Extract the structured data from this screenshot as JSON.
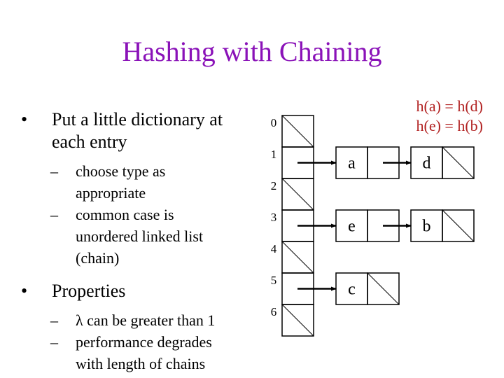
{
  "slide": {
    "title": "Hashing with Chaining",
    "bullets": [
      {
        "text_lines": [
          "Put a little dictionary at",
          "each entry"
        ],
        "subs": [
          {
            "lines": [
              "choose type as",
              "appropriate"
            ]
          },
          {
            "lines": [
              "common case is",
              "unordered linked list",
              "(chain)"
            ]
          }
        ]
      },
      {
        "text_lines": [
          "Properties"
        ],
        "subs": [
          {
            "lines": [
              "λ can be greater than 1"
            ]
          },
          {
            "lines": [
              "performance degrades",
              "with length of chains"
            ]
          }
        ]
      }
    ],
    "bullet_glyph": "•",
    "dash_glyph": "–",
    "annotation": [
      "h(a) = h(d)",
      "h(e) = h(b)"
    ],
    "colors": {
      "title": "#8a12b8",
      "annotation": "#b22222"
    }
  },
  "diagram": {
    "table_indices": [
      "0",
      "1",
      "2",
      "3",
      "4",
      "5",
      "6"
    ],
    "slots": [
      {
        "index": 0,
        "chain": []
      },
      {
        "index": 1,
        "chain": [
          "a",
          "d"
        ]
      },
      {
        "index": 2,
        "chain": []
      },
      {
        "index": 3,
        "chain": [
          "e",
          "b"
        ]
      },
      {
        "index": 4,
        "chain": []
      },
      {
        "index": 5,
        "chain": [
          "c"
        ]
      },
      {
        "index": 6,
        "chain": []
      }
    ]
  }
}
